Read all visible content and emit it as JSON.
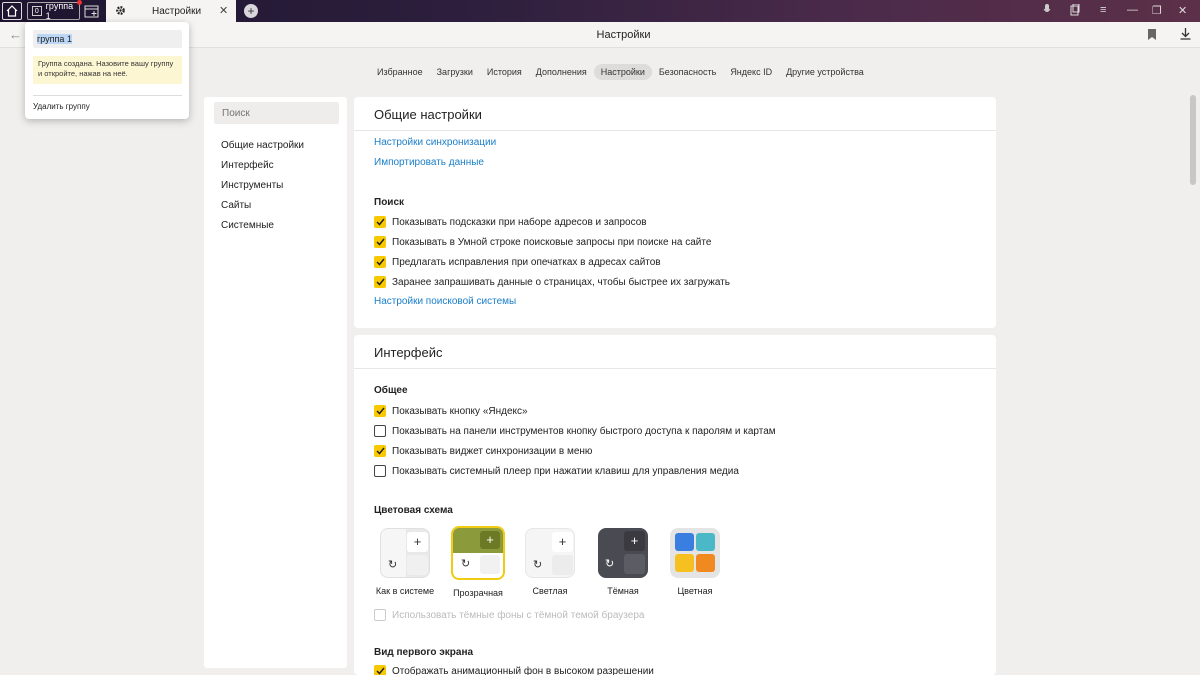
{
  "titlebar": {
    "group_count": "0",
    "group_name": "группа 1",
    "tab_title": "Настройки",
    "tab_close": "✕",
    "new_tab": "+"
  },
  "addressbar": {
    "back": "←",
    "title": "Настройки"
  },
  "nav_tabs": [
    "Избранное",
    "Загрузки",
    "История",
    "Дополнения",
    "Настройки",
    "Безопасность",
    "Яндекс ID",
    "Другие устройства"
  ],
  "nav_active": "Настройки",
  "sidebar": {
    "search_placeholder": "Поиск",
    "items": [
      "Общие настройки",
      "Интерфейс",
      "Инструменты",
      "Сайты",
      "Системные"
    ]
  },
  "general": {
    "title": "Общие настройки",
    "links": [
      "Настройки синхронизации",
      "Импортировать данные"
    ],
    "search_section": "Поиск",
    "search_options": [
      {
        "label": "Показывать подсказки при наборе адресов и запросов",
        "checked": true
      },
      {
        "label": "Показывать в Умной строке поисковые запросы при поиске на сайте",
        "checked": true
      },
      {
        "label": "Предлагать исправления при опечатках в адресах сайтов",
        "checked": true
      },
      {
        "label": "Заранее запрашивать данные о страницах, чтобы быстрее их загружать",
        "checked": true
      }
    ],
    "search_engine_link": "Настройки поисковой системы"
  },
  "interface": {
    "title": "Интерфейс",
    "common_section": "Общее",
    "common_options": [
      {
        "label": "Показывать кнопку «Яндекс»",
        "checked": true
      },
      {
        "label": "Показывать на панели инструментов кнопку быстрого доступа к паролям и картам",
        "checked": false
      },
      {
        "label": "Показывать виджет синхронизации в меню",
        "checked": true
      },
      {
        "label": "Показывать системный плеер при нажатии клавиш для управления медиа",
        "checked": false
      }
    ],
    "color_section": "Цветовая схема",
    "themes": [
      "Как в системе",
      "Прозрачная",
      "Светлая",
      "Тёмная",
      "Цветная"
    ],
    "selected_theme": "Прозрачная",
    "dark_bg_option": "Использовать тёмные фоны с тёмной темой браузера",
    "first_screen_section": "Вид первого экрана",
    "first_screen_option": "Отображать анимационный фон в высоком разрешении"
  },
  "popup": {
    "group_name_value": "группа 1",
    "note": "Группа создана. Назовите вашу группу и откройте, нажав на неё.",
    "delete": "Удалить группу"
  },
  "colors": {
    "accent_yellow": "#f9c900",
    "link_blue": "#1a7fc9",
    "transparent_theme_green": "#8b9a3a"
  }
}
